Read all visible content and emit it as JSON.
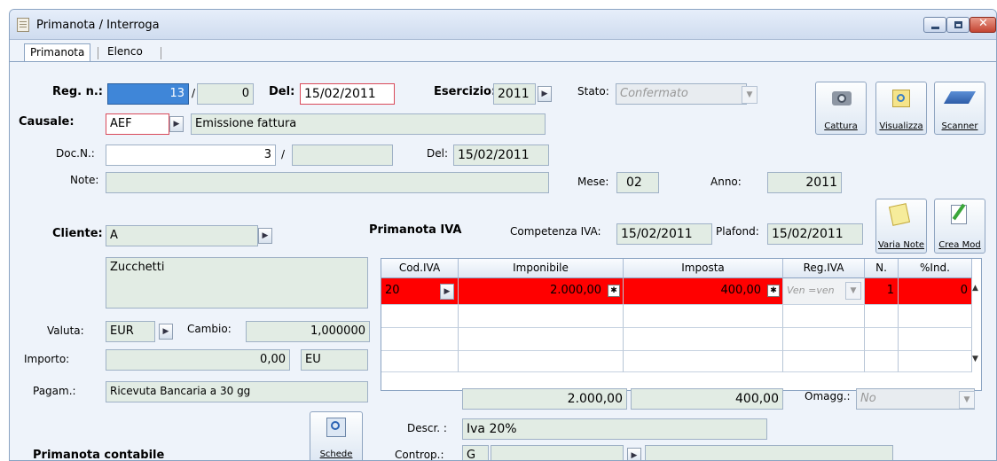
{
  "window": {
    "title": "Primanota / Interroga"
  },
  "tabs": [
    {
      "label": "Primanota"
    },
    {
      "label": "Elenco"
    }
  ],
  "header": {
    "reg_label": "Reg. n.:",
    "reg_num": "13",
    "reg_sep": "/",
    "reg_sub": "0",
    "del_label": "Del:",
    "del_value": "15/02/2011",
    "esercizio_label": "Esercizio:",
    "esercizio_value": "2011",
    "stato_label": "Stato:",
    "stato_value": "Confermato",
    "causale_label": "Causale:",
    "causale_code": "AEF",
    "causale_desc": "Emissione fattura",
    "docn_label": "Doc.N.:",
    "docn_value": "3",
    "docn_sep": "/",
    "docn_sub": "",
    "doc_del_label": "Del:",
    "doc_del_value": "15/02/2011",
    "note_label": "Note:",
    "note_value": "",
    "mese_label": "Mese:",
    "mese_value": "02",
    "anno_label": "Anno:",
    "anno_value": "2011"
  },
  "toolbar": {
    "cattura": "Cattura",
    "visualizza": "Visualizza",
    "scanner": "Scanner",
    "varia_note": "Varia Note",
    "crea_mod": "Crea Mod",
    "schede": "Schede"
  },
  "cliente": {
    "label": "Cliente:",
    "code": "A",
    "name": "Zucchetti",
    "valuta_label": "Valuta:",
    "valuta_value": "EUR",
    "cambio_label": "Cambio:",
    "cambio_value": "1,000000",
    "importo_label": "Importo:",
    "importo_value": "0,00",
    "importo_cur": "EU",
    "pagam_label": "Pagam.:",
    "pagam_value": "Ricevuta Bancaria a 30 gg"
  },
  "iva": {
    "title": "Primanota IVA",
    "competenza_label": "Competenza IVA:",
    "competenza_value": "15/02/2011",
    "plafond_label": "Plafond:",
    "plafond_value": "15/02/2011",
    "columns": [
      "Cod.IVA",
      "Imponibile",
      "Imposta",
      "Reg.IVA",
      "N.",
      "%Ind."
    ],
    "row": {
      "cod": "20",
      "imponibile": "2.000,00",
      "imposta": "400,00",
      "reg": "Ven =ven",
      "n": "1",
      "ind": "0"
    },
    "total_imponibile": "2.000,00",
    "total_imposta": "400,00",
    "omagg_label": "Omagg.:",
    "omagg_value": "No",
    "descr_label": "Descr. :",
    "descr_value": "Iva 20%",
    "controp_label": "Controp.:",
    "controp_value": "G"
  },
  "contabile": {
    "title": "Primanota contabile"
  }
}
